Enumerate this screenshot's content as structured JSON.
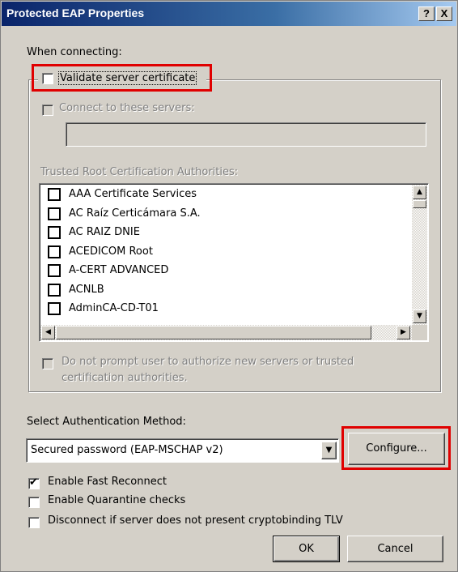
{
  "window": {
    "title": "Protected EAP Properties",
    "help_btn": "?",
    "close_btn": "X"
  },
  "when_connecting": "When connecting:",
  "validate": {
    "label": "Validate server certificate",
    "checked": false
  },
  "connect_servers": {
    "label": "Connect to these servers:",
    "value": ""
  },
  "trusted_root": {
    "label": "Trusted Root Certification Authorities:",
    "items": [
      "AAA Certificate Services",
      "AC Raíz Certicámara S.A.",
      "AC RAIZ DNIE",
      "ACEDICOM Root",
      "A-CERT ADVANCED",
      "ACNLB",
      "AdminCA-CD-T01"
    ]
  },
  "no_prompt": {
    "line1": "Do not prompt user to authorize new servers or trusted",
    "line2": "certification authorities."
  },
  "auth_method": {
    "label": "Select Authentication Method:",
    "value": "Secured password (EAP-MSCHAP v2)"
  },
  "configure_btn": "Configure...",
  "fast_reconnect": {
    "label": "Enable Fast Reconnect",
    "checked": true
  },
  "quarantine": {
    "label": "Enable Quarantine checks",
    "checked": false
  },
  "cryptobinding": {
    "label": "Disconnect if server does not present cryptobinding TLV",
    "checked": false
  },
  "ok_btn": "OK",
  "cancel_btn": "Cancel"
}
